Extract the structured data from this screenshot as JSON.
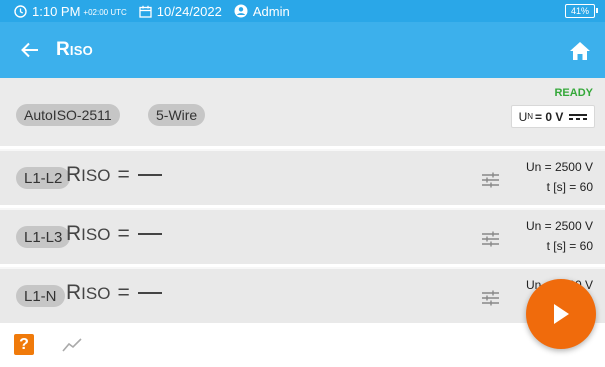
{
  "status_bar": {
    "time": "1:10 PM",
    "timezone": "+02:00 UTC",
    "date": "10/24/2022",
    "user": "Admin",
    "battery": "41%"
  },
  "app_bar": {
    "title_main": "R",
    "title_sub": "ISO",
    "icons": {
      "back": "arrow-left-icon",
      "home": "home-icon"
    }
  },
  "info_row": {
    "procedure": "AutoISO-2511",
    "wiring": "5-Wire",
    "status": "READY",
    "voltage_label_main": "U",
    "voltage_label_sub": "N",
    "voltage_value": "= 0 V",
    "voltage_type_icon": "dc-icon"
  },
  "measurements": [
    {
      "pair": "L1-L2",
      "symbol_main": "R",
      "symbol_sub": "ISO",
      "equals": "=",
      "un": "Un = 2500 V",
      "t": "t [s] = 60"
    },
    {
      "pair": "L1-L3",
      "symbol_main": "R",
      "symbol_sub": "ISO",
      "equals": "=",
      "un": "Un = 2500 V",
      "t": "t [s] = 60"
    },
    {
      "pair": "L1-N",
      "symbol_main": "R",
      "symbol_sub": "ISO",
      "equals": "=",
      "un": "Un = 2500 V",
      "t": ""
    }
  ],
  "bottom_bar": {
    "help_label": "?",
    "icons": {
      "help": "help-icon",
      "trend": "trend-chart-icon"
    }
  },
  "fab": {
    "icon": "play-icon"
  },
  "colors": {
    "status_bar": "#2aa7e8",
    "app_bar": "#3cb0ec",
    "ready": "#35a83a",
    "accent": "#f06b0c"
  }
}
